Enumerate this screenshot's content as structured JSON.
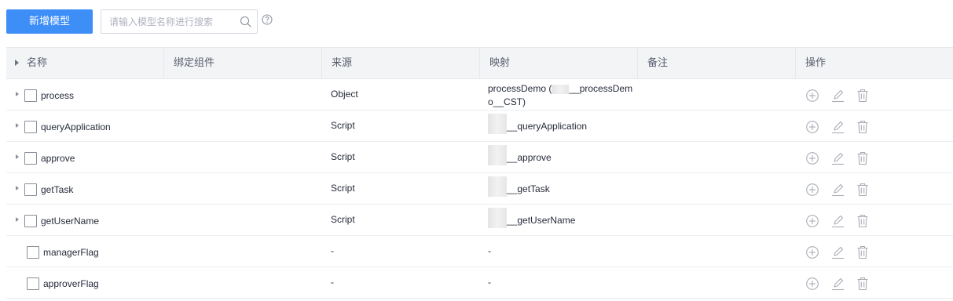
{
  "toolbar": {
    "add_label": "新增模型",
    "search_placeholder": "请输入模型名称进行搜索"
  },
  "table": {
    "headers": [
      "名称",
      "绑定组件",
      "来源",
      "映射",
      "备注",
      "操作"
    ],
    "rows": [
      {
        "name": "process",
        "source": "Object",
        "mapping_line1_pre": "processDemo (",
        "mapping_line1_post": "__processDem",
        "mapping_line2": "o__CST)",
        "expandable": true
      },
      {
        "name": "queryApplication",
        "source": "Script",
        "mapping": "__queryApplication",
        "expandable": true
      },
      {
        "name": "approve",
        "source": "Script",
        "mapping": "__approve",
        "expandable": true
      },
      {
        "name": "getTask",
        "source": "Script",
        "mapping": "__getTask",
        "expandable": true
      },
      {
        "name": "getUserName",
        "source": "Script",
        "mapping": "__getUserName",
        "expandable": true
      },
      {
        "name": "managerFlag",
        "source": "-",
        "mapping": "-",
        "expandable": false
      },
      {
        "name": "approverFlag",
        "source": "-",
        "mapping": "-",
        "expandable": false
      }
    ]
  },
  "icons": {
    "search": "search-icon",
    "help": "help-circle-icon",
    "add": "add-circle-icon",
    "edit": "edit-icon",
    "delete": "trash-icon"
  },
  "colors": {
    "primary": "#3e8ef7",
    "header_bg": "#f3f4f6",
    "icon_gray": "#a8acb5"
  }
}
